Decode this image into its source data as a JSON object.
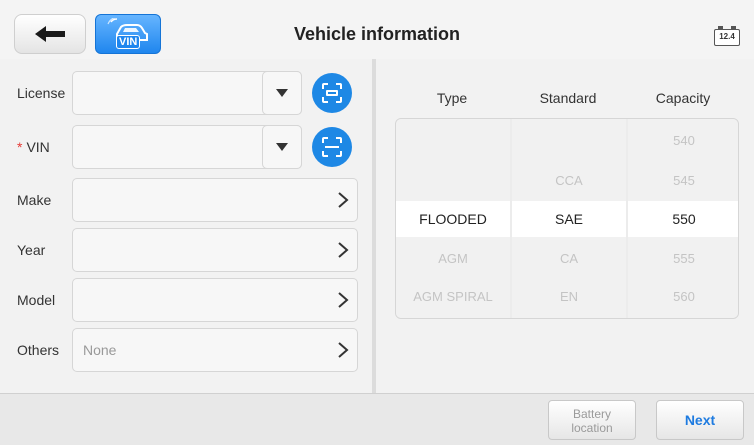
{
  "header": {
    "title": "Vehicle information",
    "back_icon": "back-arrow-icon",
    "vin_icon": "vin-scan-car-icon",
    "vin_badge": "VIN",
    "battery_voltage": "12.4"
  },
  "form": {
    "license": {
      "label": "License",
      "value": ""
    },
    "vin": {
      "required_mark": "*",
      "label": "VIN",
      "value": ""
    },
    "make": {
      "label": "Make",
      "value": ""
    },
    "year": {
      "label": "Year",
      "value": ""
    },
    "model": {
      "label": "Model",
      "value": ""
    },
    "others": {
      "label": "Others",
      "value": "None"
    }
  },
  "battery_table": {
    "headers": [
      "Type",
      "Standard",
      "Capacity"
    ],
    "type_options": [
      "",
      "",
      "FLOODED",
      "AGM",
      "AGM SPIRAL"
    ],
    "standard_options": [
      "",
      "CCA",
      "SAE",
      "CA",
      "EN"
    ],
    "capacity_options": [
      "540",
      "545",
      "550",
      "555",
      "560"
    ],
    "selected": {
      "type": "FLOODED",
      "standard": "SAE",
      "capacity": "550"
    }
  },
  "footer": {
    "battery_location_line1": "Battery",
    "battery_location_line2": "location",
    "next_label": "Next"
  },
  "colors": {
    "accent": "#1e88e5",
    "required": "#e53935",
    "next_text": "#1e7be0"
  }
}
